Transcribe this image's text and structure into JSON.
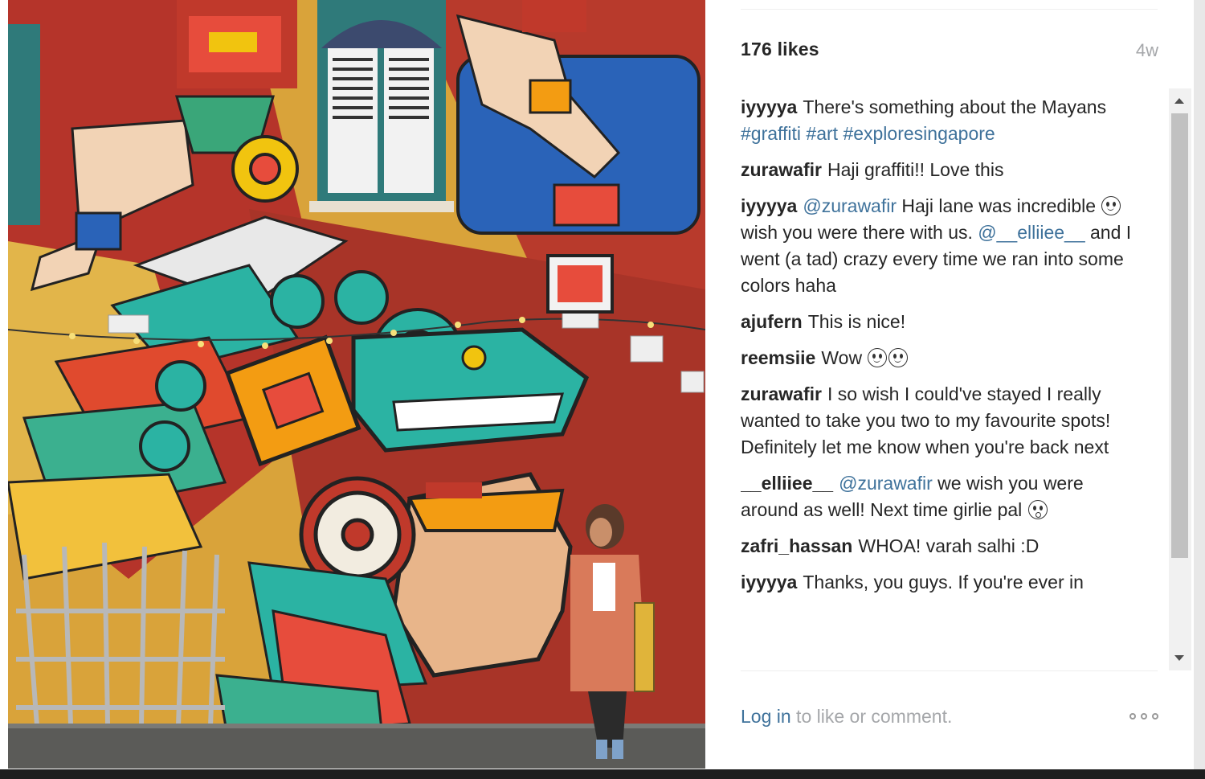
{
  "post": {
    "likes": "176 likes",
    "time_ago": "4w"
  },
  "comments": [
    {
      "user": "iyyyya",
      "parts": [
        {
          "type": "text",
          "value": "There's something about the Mayans"
        },
        {
          "type": "br"
        },
        {
          "type": "tag",
          "value": "#graffiti"
        },
        {
          "type": "text",
          "value": " "
        },
        {
          "type": "tag",
          "value": "#art"
        },
        {
          "type": "text",
          "value": " "
        },
        {
          "type": "tag",
          "value": "#exploresingapore"
        }
      ]
    },
    {
      "user": "zurawafir",
      "parts": [
        {
          "type": "text",
          "value": "Haji graffiti!! Love this"
        }
      ]
    },
    {
      "user": "iyyyya",
      "parts": [
        {
          "type": "mention",
          "value": "@zurawafir"
        },
        {
          "type": "text",
          "value": " Haji lane was incredible "
        },
        {
          "type": "emoji",
          "value": "smile"
        },
        {
          "type": "text",
          "value": " wish you were there with us. "
        },
        {
          "type": "mention",
          "value": "@__elliiee__"
        },
        {
          "type": "text",
          "value": " and I went (a tad) crazy every time we ran into some colors haha"
        }
      ]
    },
    {
      "user": "ajufern",
      "parts": [
        {
          "type": "text",
          "value": "This is nice!"
        }
      ]
    },
    {
      "user": "reemsiie",
      "parts": [
        {
          "type": "text",
          "value": "Wow "
        },
        {
          "type": "emoji",
          "value": "smile"
        },
        {
          "type": "emoji",
          "value": "smile"
        }
      ]
    },
    {
      "user": "zurawafir",
      "parts": [
        {
          "type": "text",
          "value": "I so wish I could've stayed I really wanted to take you two to my favourite spots! Definitely let me know when you're back next"
        }
      ]
    },
    {
      "user": "__elliiee__",
      "parts": [
        {
          "type": "mention",
          "value": "@zurawafir"
        },
        {
          "type": "text",
          "value": " we wish you were around as well! Next time girlie pal "
        },
        {
          "type": "emoji",
          "value": "wow"
        }
      ]
    },
    {
      "user": "zafri_hassan",
      "parts": [
        {
          "type": "text",
          "value": "WHOA! varah salhi :D"
        }
      ]
    },
    {
      "user": "iyyyya",
      "parts": [
        {
          "type": "text",
          "value": "Thanks, you guys. If you're ever in"
        }
      ]
    }
  ],
  "footer": {
    "login_link": "Log in",
    "login_rest": " to like or comment."
  },
  "icons": {
    "more_options": "more-options-icon",
    "scroll_up": "scroll-up-arrow-icon",
    "scroll_down": "scroll-down-arrow-icon"
  },
  "colors": {
    "link_blue": "#3f729b",
    "muted_gray": "#a5a7aa",
    "text_dark": "#262626"
  }
}
